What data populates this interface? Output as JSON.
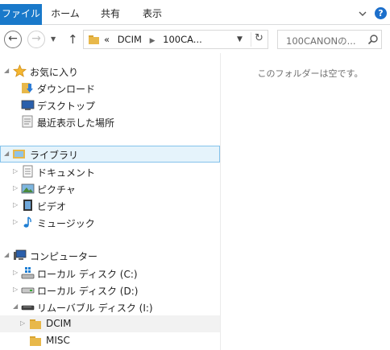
{
  "ribbon": {
    "tabs": [
      "ファイル",
      "ホーム",
      "共有",
      "表示"
    ]
  },
  "address": {
    "overflow": "«",
    "crumbs": [
      "DCIM",
      "100CA..."
    ],
    "search_placeholder": "100CANONの..."
  },
  "nav": {
    "favorites": {
      "label": "お気に入り",
      "items": [
        "ダウンロード",
        "デスクトップ",
        "最近表示した場所"
      ]
    },
    "libraries": {
      "label": "ライブラリ",
      "items": [
        "ドキュメント",
        "ピクチャ",
        "ビデオ",
        "ミュージック"
      ]
    },
    "computer": {
      "label": "コンピューター",
      "items": [
        "ローカル ディスク (C:)",
        "ローカル ディスク (D:)",
        "リムーバブル ディスク (I:)"
      ],
      "removable_children": [
        "DCIM",
        "MISC"
      ]
    }
  },
  "content": {
    "empty_message": "このフォルダーは空です。"
  },
  "colors": {
    "file_tab": "#1979ca",
    "selection_bg": "#e5f3fb",
    "selection_border": "#84c2eb",
    "folder": "#e8b84a"
  }
}
